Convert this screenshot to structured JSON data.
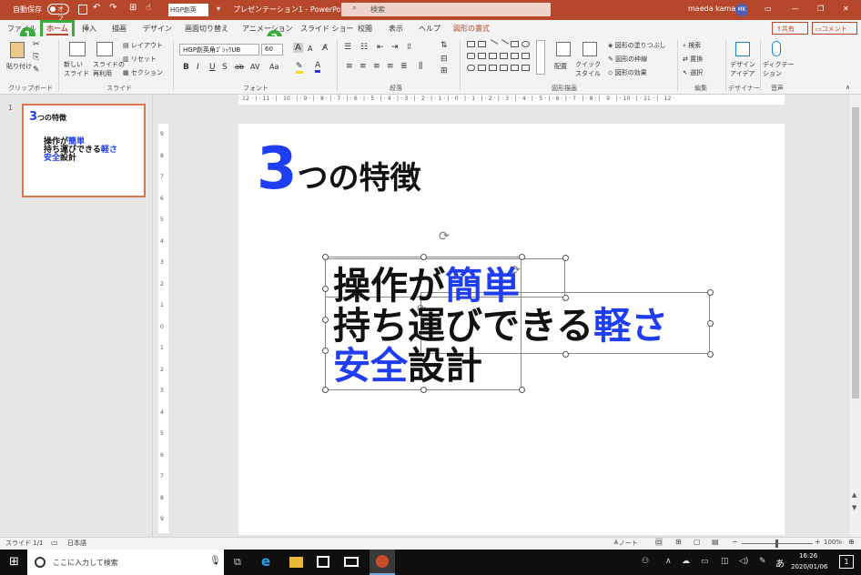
{
  "titlebar": {
    "autosave": "自動保存",
    "autosave_state": "オフ",
    "font_box": "HGP創英",
    "doc_title": "プレゼンテーション1 - PowerPo···",
    "search_placeholder": "検索",
    "user": "maeda kamari",
    "avatar": "MK"
  },
  "tabs": [
    "ファイル",
    "ホーム",
    "挿入",
    "描画",
    "デザイン",
    "画面切り替え",
    "アニメーション",
    "スライド ショー",
    "校閲",
    "表示",
    "ヘルプ",
    "図形の書式"
  ],
  "share_label": "共有",
  "comment_label": "コメント",
  "ribbon": {
    "paste": "貼り付け",
    "new_slide": "新しい\nスライド",
    "reuse": "スライドの\n再利用",
    "layout": "レイアウト",
    "reset": "リセット",
    "section": "セクション",
    "font_name": "HGP創英角ｺﾞｼｯｸUB",
    "font_size": "60",
    "grow": "A",
    "shrink": "A",
    "bold": "B",
    "italic": "I",
    "underline": "U",
    "strike": "S",
    "ab": "ab",
    "av": "AV",
    "aa": "Aa",
    "arrange": "配置",
    "quick_style": "クイック\nスタイル",
    "fill": "図形の塗りつぶし",
    "outline": "図形の枠線",
    "effect": "図形の効果",
    "find": "検索",
    "replace": "置換",
    "select": "選択",
    "designer": "デザイン\nアイデア",
    "dictate": "ディクテー\nション"
  },
  "groups": [
    "クリップボード",
    "スライド",
    "フォント",
    "段落",
    "図形描画",
    "編集",
    "デザイナー",
    "音声"
  ],
  "badges": [
    "1",
    "2"
  ],
  "ruler_h": "· 12 · | · 11 · | · 10 · | · 9 · | · 8 · | · 7 · | · 6 · | · 5 · | · 4 · | · 3 · | · 2 · | · 1 · | · 0 · | · 1 · | · 2 · | · 3 · | · 4 · | · 5 · | · 6 · | · 7 · | · 8 · | · 9 · | · 10 · | · 11 · | · 12 ·",
  "ruler_v": [
    "9",
    "8",
    "7",
    "6",
    "5",
    "4",
    "3",
    "2",
    "1",
    "0",
    "1",
    "2",
    "3",
    "4",
    "5",
    "6",
    "7",
    "8",
    "9"
  ],
  "thumb": {
    "num": "1",
    "title_num": "3",
    "title_rest": "つの特徴",
    "l1a": "操作が",
    "l1b": "簡単",
    "l2a": "持ち運びできる",
    "l2b": "軽さ",
    "l3a": "安全",
    "l3b": "設計"
  },
  "slide": {
    "title_num": "3",
    "title_rest": "つの特徴",
    "l1a": "操作が",
    "l1b": "簡単",
    "l2a": "持ち運びできる",
    "l2b": "軽さ",
    "l3a": "安全",
    "l3b": "設計"
  },
  "status": {
    "slide": "スライド 1/1",
    "lang": "日本語",
    "note": "ノート",
    "zoom": "100%"
  },
  "taskbar": {
    "search": "ここに入力して検索",
    "ime": "あ",
    "time": "16:26",
    "date": "2020/01/06",
    "notif": "1"
  },
  "colors": {
    "accent": "#b7472a",
    "blue": "#1f3df2",
    "green": "#3daa3d"
  }
}
